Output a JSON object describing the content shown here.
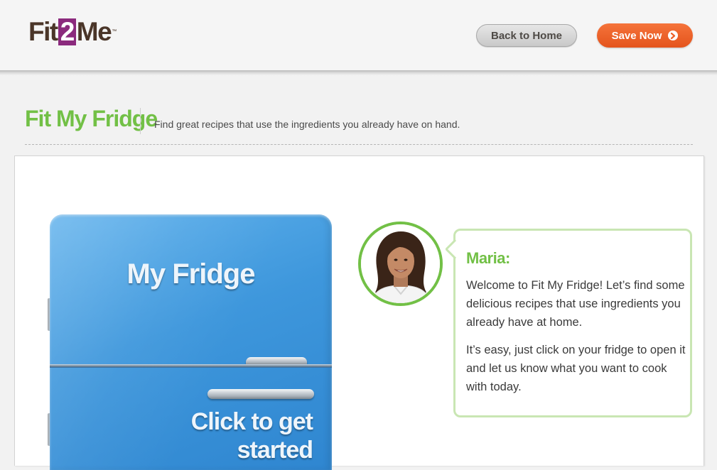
{
  "header": {
    "logo": {
      "part1": "Fit",
      "part2": "2",
      "part3": "Me",
      "tm": "™"
    },
    "back_home_label": "Back to Home",
    "save_now_label": "Save Now"
  },
  "page": {
    "title": "Fit My Fridge",
    "subtitle": "Find great recipes that use the ingredients you already have on hand."
  },
  "fridge": {
    "label": "My Fridge",
    "cta_line1": "Click to get",
    "cta_line2": "started"
  },
  "chat": {
    "name": "Maria:",
    "paragraph1": "Welcome to Fit My Fridge! Let’s find some delicious recipes that use ingredients you already have at home.",
    "paragraph2": "It’s easy, just click on your fridge to open it and let us know what you want to cook with today."
  },
  "icons": {
    "save_arrow": "chevron-right-circle-icon",
    "avatar": "avatar"
  },
  "colors": {
    "brand_green": "#72c046",
    "brand_purple": "#8b2a7d",
    "brand_brown": "#4a3528",
    "save_orange": "#ee6128",
    "fridge_blue": "#3e97dc",
    "bubble_border": "#c9e6b3"
  }
}
